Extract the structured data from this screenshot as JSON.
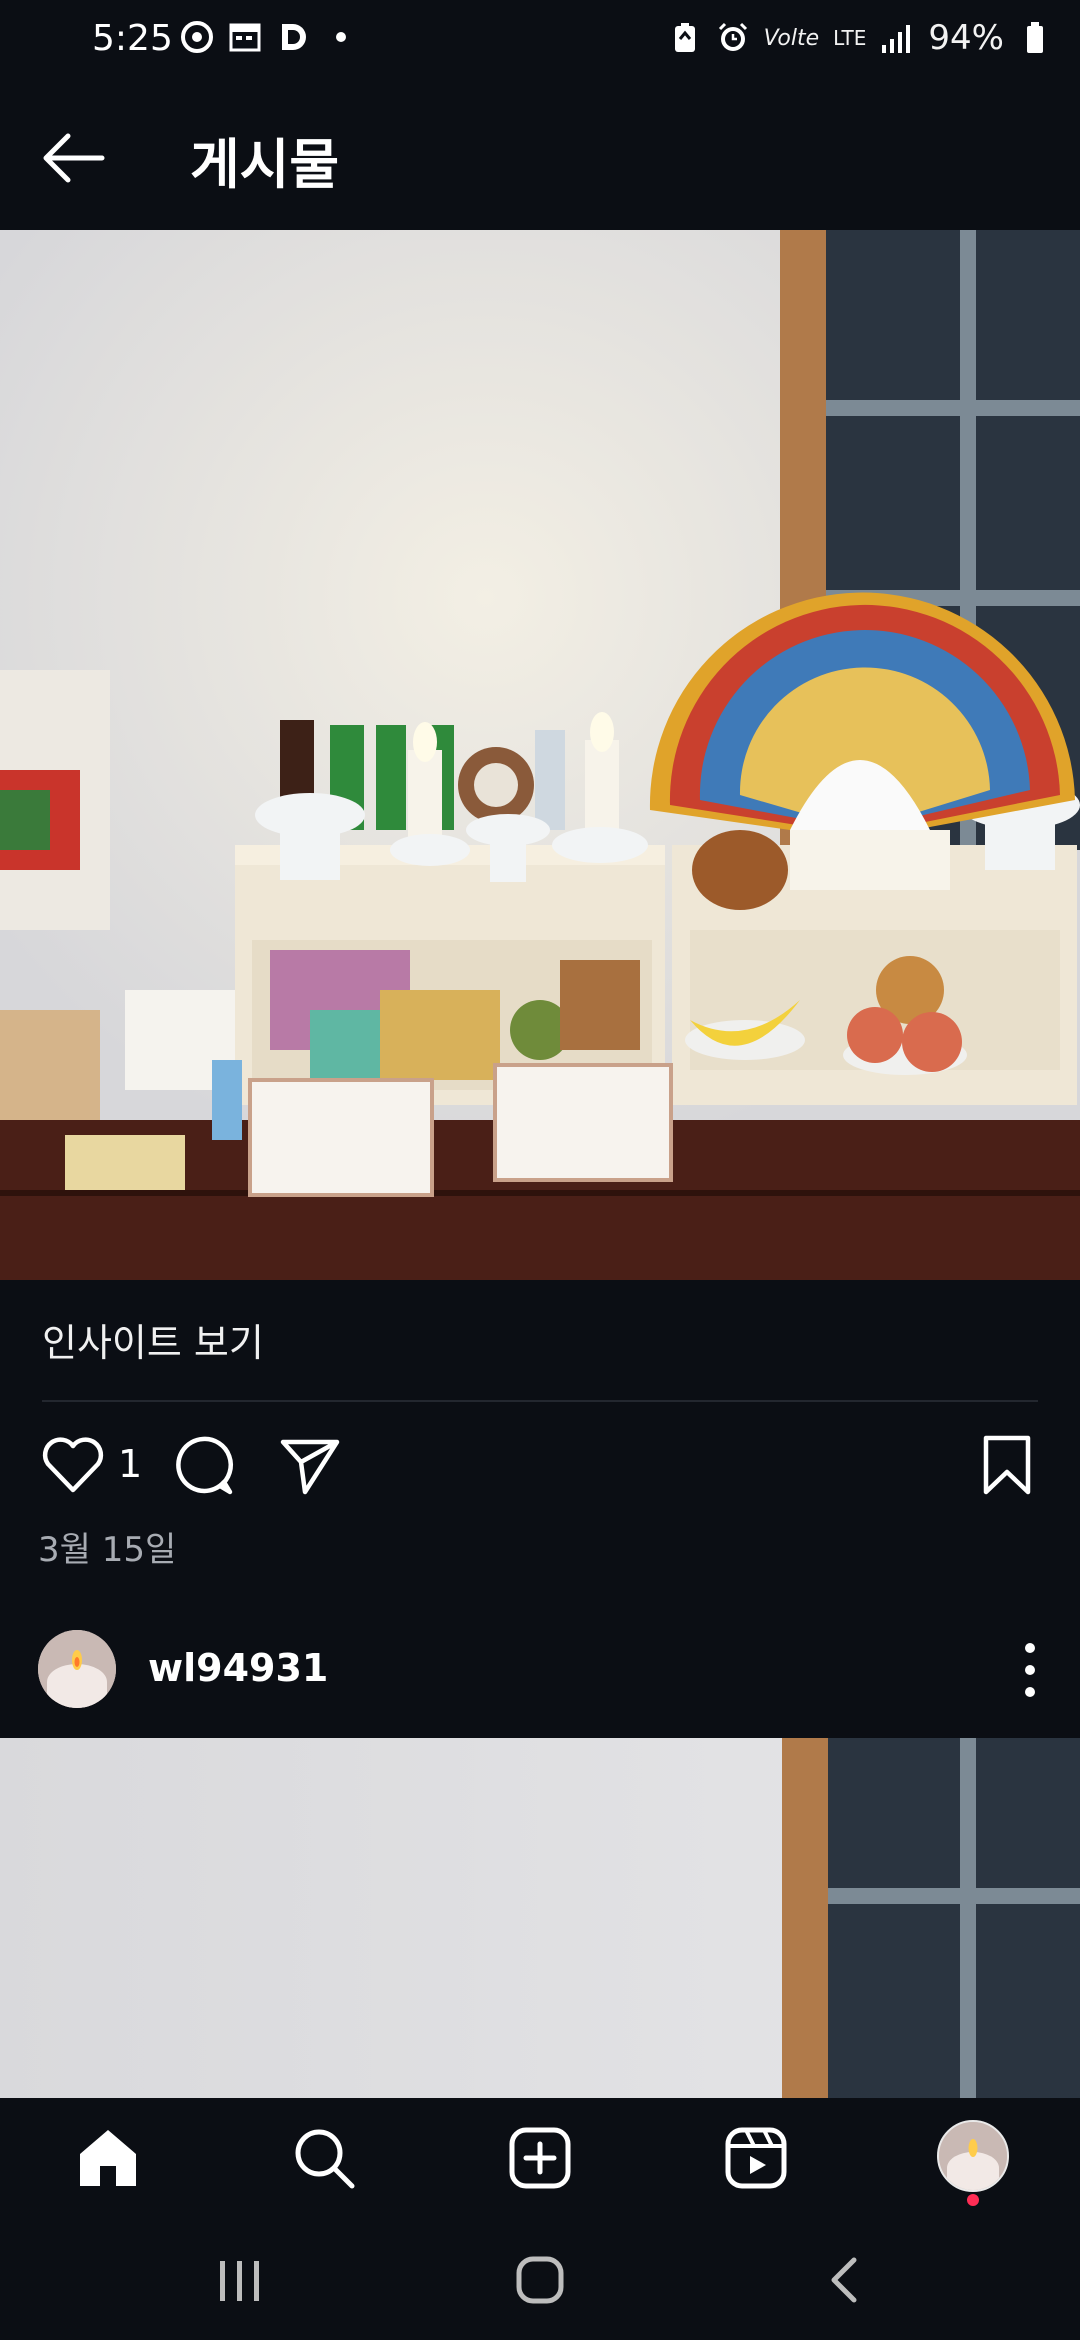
{
  "status_bar": {
    "time": "5:25",
    "battery": "94%",
    "network": "LTE",
    "volte": "Volte",
    "icons": [
      "chrome-icon",
      "calendar-icon",
      "d-app-icon",
      "dot-icon",
      "battery-saver-icon",
      "alarm-icon",
      "volte-icon",
      "lte-icon",
      "signal-icon",
      "battery-icon"
    ]
  },
  "header": {
    "title": "게시물",
    "back_icon": "arrow-left-icon"
  },
  "post": {
    "insight_link": "인사이트 보기",
    "like_count": "1",
    "date": "3월 15일"
  },
  "next_post": {
    "username": "wl94931"
  },
  "bottom_nav": {
    "items": [
      "home-icon",
      "search-icon",
      "create-icon",
      "reels-icon",
      "profile-avatar"
    ]
  },
  "system_nav": [
    "recents-icon",
    "home-circle-icon",
    "back-chevron-icon"
  ],
  "colors": {
    "background": "#0b0e14",
    "text": "#f2f2f2",
    "muted": "#a8acb3",
    "notification": "#ff2d55"
  }
}
